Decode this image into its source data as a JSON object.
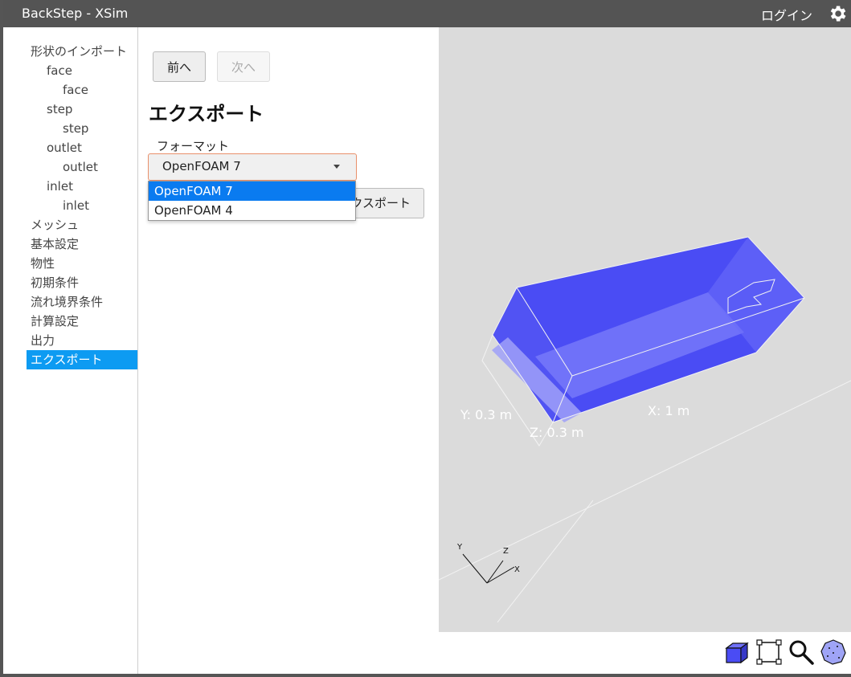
{
  "window": {
    "title": "BackStep - XSim",
    "login_label": "ログイン"
  },
  "sidebar": {
    "items": [
      {
        "label": "形状のインポート"
      },
      {
        "label": "face"
      },
      {
        "label": "face"
      },
      {
        "label": "step"
      },
      {
        "label": "step"
      },
      {
        "label": "outlet"
      },
      {
        "label": "outlet"
      },
      {
        "label": "inlet"
      },
      {
        "label": "inlet"
      },
      {
        "label": "メッシュ"
      },
      {
        "label": "基本設定"
      },
      {
        "label": "物性"
      },
      {
        "label": "初期条件"
      },
      {
        "label": "流れ境界条件"
      },
      {
        "label": "計算設定"
      },
      {
        "label": "出力"
      },
      {
        "label": "エクスポート"
      }
    ],
    "selected": "エクスポート"
  },
  "panel": {
    "prev_label": "前へ",
    "next_label": "次へ",
    "heading": "エクスポート",
    "format_label": "フォーマット",
    "format_selected": "OpenFOAM 7",
    "format_options": [
      "OpenFOAM 7",
      "OpenFOAM 4"
    ],
    "export_label": "エクスポート"
  },
  "viewport": {
    "dims": {
      "x": "X: 1 m",
      "y": "Y: 0.3 m",
      "z": "Z: 0.3 m"
    },
    "axes": {
      "x": "X",
      "y": "Y",
      "z": "Z"
    },
    "colors": {
      "background": "#dbdbdb",
      "solid": "#4a4cf4",
      "edges": "#f2f2f2"
    }
  },
  "toolbar": {
    "icons": [
      "solid-cube-icon",
      "bounding-box-icon",
      "zoom-icon",
      "mesh-sphere-icon"
    ]
  }
}
